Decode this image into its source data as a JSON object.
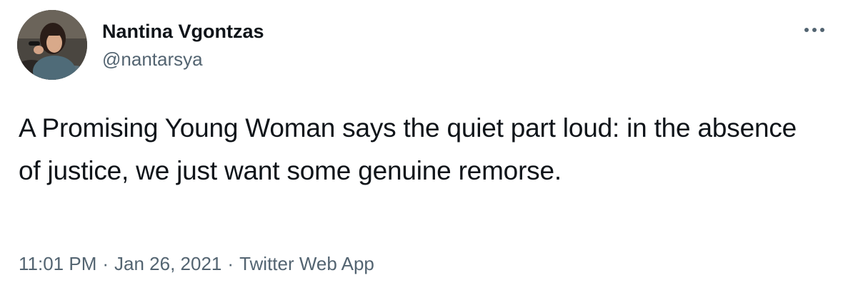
{
  "tweet": {
    "author": {
      "display_name": "Nantina Vgontzas",
      "handle": "@nantarsya",
      "avatar_icon": "profile-photo"
    },
    "more_icon": "more-horizontal-icon",
    "text": "A Promising Young Woman says the quiet part loud: in the absence of justice, we just want some genuine remorse.",
    "time": "11:01 PM",
    "date": "Jan 26, 2021",
    "separator": "·",
    "source": "Twitter Web App"
  },
  "colors": {
    "primary_text": "#0f1419",
    "secondary_text": "#536471",
    "background": "#ffffff"
  }
}
